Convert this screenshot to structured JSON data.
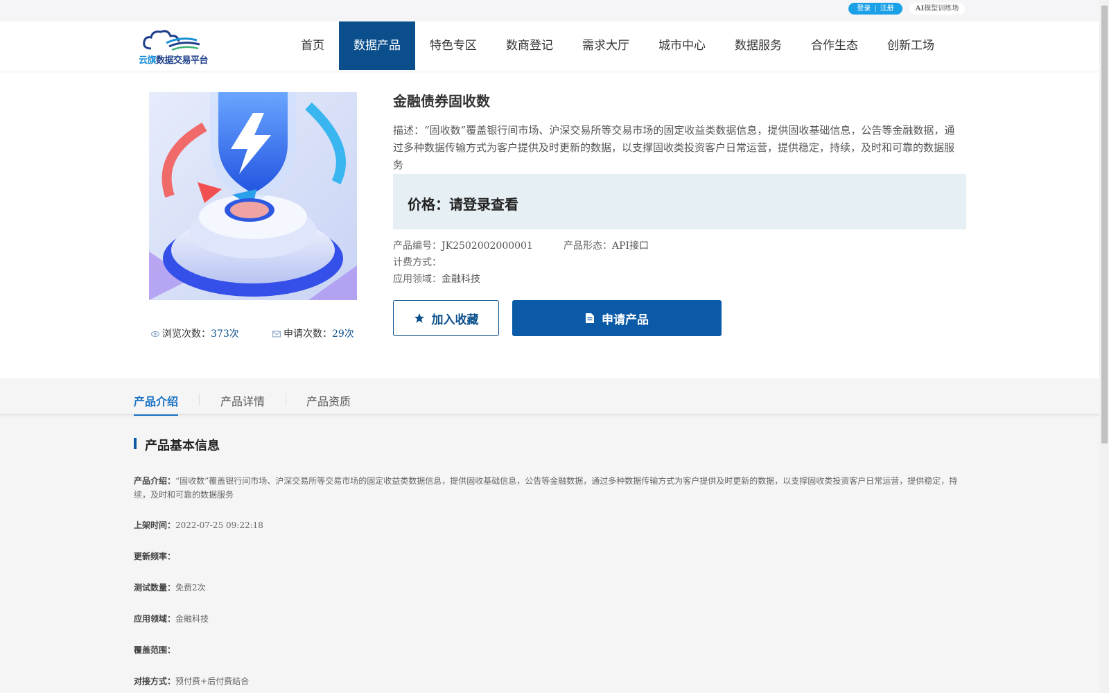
{
  "topbar": {
    "login": "登录",
    "separator": "|",
    "register": "注册",
    "ai_prefix": "AI",
    "ai_suffix": "模型训练场"
  },
  "logo": {
    "part1": "云旗",
    "part2": "数据交易平台"
  },
  "nav": {
    "items": [
      {
        "label": "首页",
        "active": false
      },
      {
        "label": "数据产品",
        "active": true
      },
      {
        "label": "特色专区",
        "active": false
      },
      {
        "label": "数商登记",
        "active": false
      },
      {
        "label": "需求大厅",
        "active": false
      },
      {
        "label": "城市中心",
        "active": false
      },
      {
        "label": "数据服务",
        "active": false
      },
      {
        "label": "合作生态",
        "active": false
      },
      {
        "label": "创新工场",
        "active": false
      }
    ]
  },
  "product": {
    "title": "金融债券固收数",
    "description": "描述：“固收数”覆盖银行间市场、沪深交易所等交易市场的固定收益类数据信息，提供固收基础信息，公告等金融数据，通过多种数据传输方式为客户提供及时更新的数据，以支撑固收类投资客户日常运营，提供稳定，持续，及时和可靠的数据服务",
    "price": "价格：请登录查看",
    "code_label": "产品编号：",
    "code_value": "JK2502002000001",
    "form_label": "产品形态：",
    "form_value": "API接口",
    "billing_label": "计费方式：",
    "field_label": "应用领域：",
    "field_value": "金融科技",
    "views_label": "浏览次数：",
    "views_value": "373次",
    "apply_label": "申请次数：",
    "apply_value": "29次",
    "fav_button": "加入收藏",
    "apply_button": "申请产品"
  },
  "tabs": [
    {
      "label": "产品介绍",
      "active": true
    },
    {
      "label": "产品详情",
      "active": false
    },
    {
      "label": "产品资质",
      "active": false
    }
  ],
  "basic": {
    "title": "产品基本信息",
    "intro_label": "产品介绍：",
    "intro_value": "“固收数”覆盖银行间市场、沪深交易所等交易市场的固定收益类数据信息，提供固收基础信息，公告等金融数据，通过多种数据传输方式为客户提供及时更新的数据，以支撑固收类投资客户日常运营，提供稳定，持续，及时和可靠的数据服务",
    "listed_label": "上架时间：",
    "listed_value": "2022-07-25 09:22:18",
    "freq_label": "更新频率：",
    "test_label": "测试数量：",
    "test_value": "免费2次",
    "field_label": "应用领域：",
    "field_value": "金融科技",
    "coverage_label": "覆盖范围：",
    "connect_label": "对接方式：",
    "connect_value": "预付费+后付费结合"
  },
  "colors": {
    "primary": "#0a4f8c",
    "accent": "#1aa0e6",
    "price_bg": "#e6eff3"
  }
}
